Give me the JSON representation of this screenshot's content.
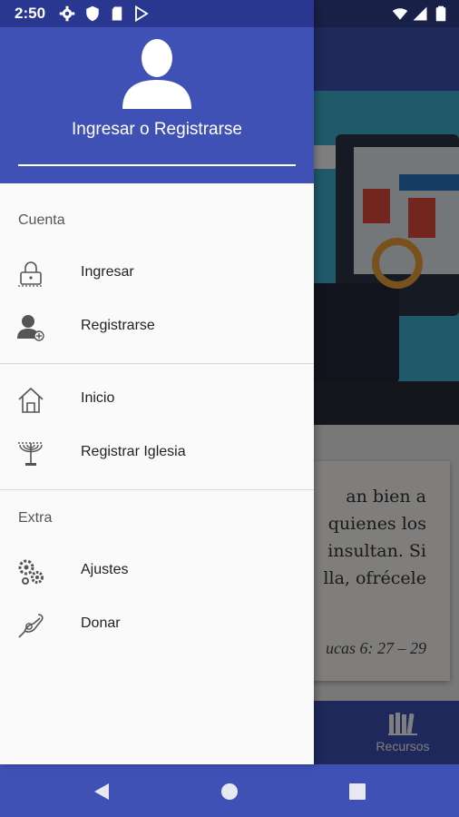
{
  "status": {
    "time": "2:50"
  },
  "drawer": {
    "header": {
      "title": "Ingresar o Registrarse"
    },
    "sections": [
      {
        "label": "Cuenta",
        "items": [
          {
            "label": "Ingresar",
            "icon": "lock-icon"
          },
          {
            "label": "Registrarse",
            "icon": "add-user-icon"
          }
        ]
      },
      {
        "label": "",
        "items": [
          {
            "label": "Inicio",
            "icon": "home-icon"
          },
          {
            "label": "Registrar Iglesia",
            "icon": "menorah-icon"
          }
        ]
      },
      {
        "label": "Extra",
        "items": [
          {
            "label": "Ajustes",
            "icon": "gears-icon"
          },
          {
            "label": "Donar",
            "icon": "donate-icon"
          }
        ]
      }
    ]
  },
  "background": {
    "verse": "an    bien a\nquienes  los\ninsultan. Si\nlla,  ofrécele",
    "reference": "ucas 6: 27 – 29",
    "bottom_tab": {
      "label": "Recursos",
      "icon": "books-icon"
    }
  },
  "colors": {
    "primary": "#3f51b5",
    "primary_dark": "#2a3790",
    "drawer_bg": "#fafafa"
  }
}
